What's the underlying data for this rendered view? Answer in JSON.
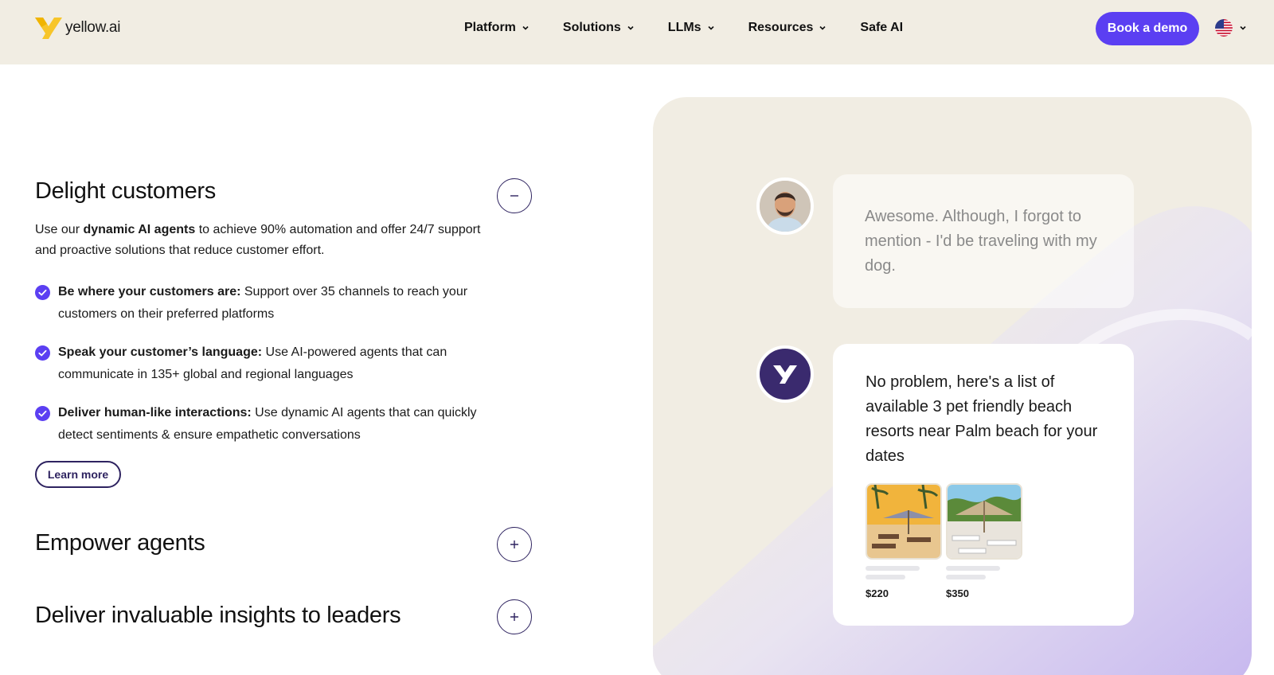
{
  "header": {
    "logo_text": "yellow.ai",
    "nav": [
      {
        "label": "Platform"
      },
      {
        "label": "Solutions"
      },
      {
        "label": "LLMs"
      },
      {
        "label": "Resources"
      },
      {
        "label": "Safe AI"
      }
    ],
    "cta_label": "Book a demo",
    "language_icon": "us-flag-icon",
    "accent_color": "#5b3ff2"
  },
  "accordion": {
    "open_section": {
      "title": "Delight customers",
      "intro_prefix": "Use our ",
      "intro_bold": "dynamic AI agents",
      "intro_suffix": " to achieve 90% automation and offer 24/7 support and proactive solutions that reduce customer effort.",
      "features": [
        {
          "bold": "Be where your customers are:",
          "text": " Support over 35 channels to reach your customers on their preferred platforms"
        },
        {
          "bold": "Speak your customer’s language:",
          "text": " Use AI-powered agents that can communicate in 135+ global and regional languages"
        },
        {
          "bold": "Deliver human-like interactions:",
          "text": " Use dynamic AI agents that can quickly detect sentiments & ensure empathetic conversations"
        }
      ],
      "learn_more_label": "Learn more"
    },
    "collapsed_sections": [
      {
        "title": "Empower agents"
      },
      {
        "title": "Deliver invaluable insights to leaders"
      }
    ]
  },
  "chat": {
    "user_message": "Awesome. Although, I forgot to mention - I'd be traveling with my dog.",
    "bot_message": "No problem, here's a list of available 3 pet friendly beach resorts near Palm beach for your dates",
    "resorts": [
      {
        "price": "$220"
      },
      {
        "price": "$350"
      }
    ]
  }
}
